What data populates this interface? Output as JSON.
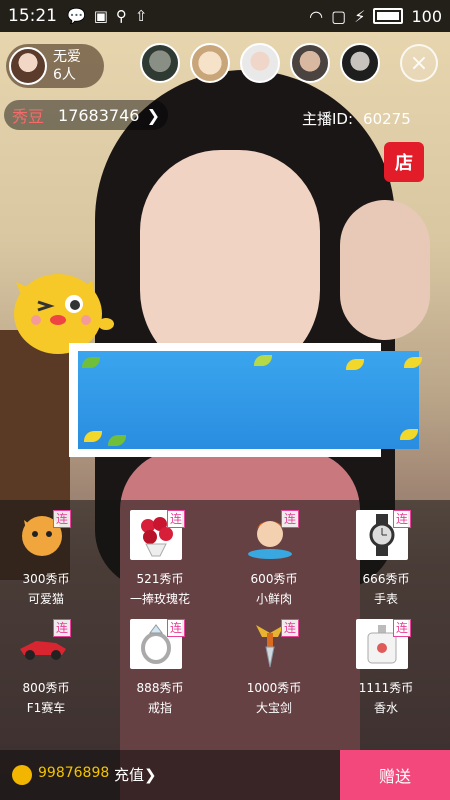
{
  "status_bar": {
    "time": "15:21",
    "battery": "100"
  },
  "host": {
    "name": "无爱",
    "viewers": "6人"
  },
  "beans": {
    "label": "秀豆",
    "value": "17683746",
    "arrow": "❯"
  },
  "anchor": {
    "label": "主播ID:",
    "value": "60275"
  },
  "shop": {
    "label": "店"
  },
  "close": {
    "label": "×"
  },
  "gift_tag": "连",
  "gifts": [
    {
      "price": "300秀币",
      "name": "可爱猫"
    },
    {
      "price": "521秀币",
      "name": "一捧玫瑰花"
    },
    {
      "price": "600秀币",
      "name": "小鲜肉"
    },
    {
      "price": "666秀币",
      "name": "手表"
    },
    {
      "price": "800秀币",
      "name": "F1赛车"
    },
    {
      "price": "888秀币",
      "name": "戒指"
    },
    {
      "price": "1000秀币",
      "name": "大宝剑"
    },
    {
      "price": "1111秀币",
      "name": "香水"
    }
  ],
  "wallet": {
    "balance": "99876898",
    "recharge": "充值❯"
  },
  "send": {
    "label": "赠送"
  },
  "colors": {
    "send": "#f2487c",
    "tag": "#e8429a",
    "beans_label": "#f76a6a",
    "shop": "#e31c2a"
  }
}
